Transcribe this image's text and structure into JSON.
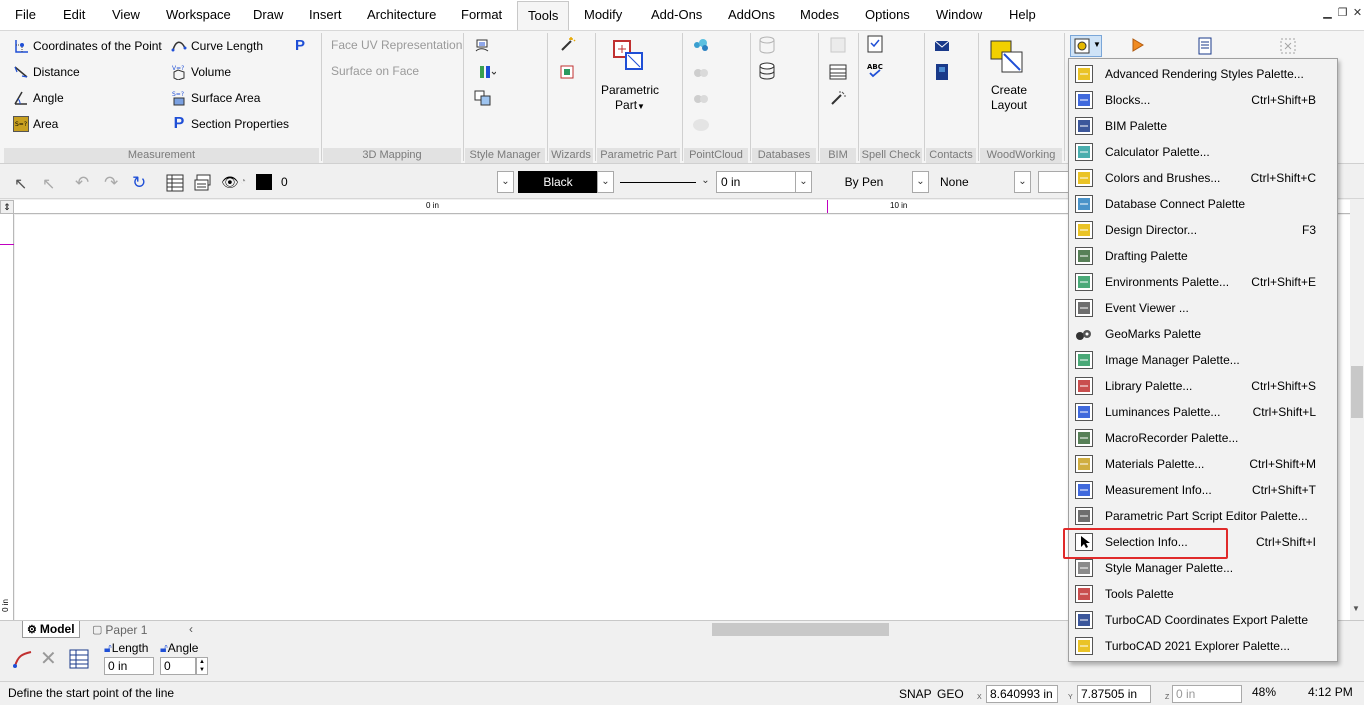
{
  "menubar": {
    "items": [
      "File",
      "Edit",
      "View",
      "Workspace",
      "Draw",
      "Insert",
      "Architecture",
      "Format",
      "Tools",
      "Modify",
      "Add-Ons",
      "AddOns",
      "Modes",
      "Options",
      "Window",
      "Help"
    ],
    "active": "Tools"
  },
  "ribbon": {
    "measurement": {
      "coordinates": "Coordinates of the Point",
      "curve_length": "Curve Length",
      "distance": "Distance",
      "volume": "Volume",
      "angle": "Angle",
      "surface_area": "Surface Area",
      "area": "Area",
      "section_properties": "Section Properties",
      "label": "Measurement"
    },
    "mapping": {
      "face_uv": "Face UV Representation",
      "surface_on_face": "Surface on Face",
      "label": "3D Mapping"
    },
    "style_manager_label": "Style Manager",
    "wizards_label": "Wizards",
    "parametric_part": {
      "line1": "Parametric",
      "line2": "Part",
      "label": "Parametric Part"
    },
    "pointcloud_label": "PointCloud",
    "databases_label": "Databases",
    "bim_label": "BIM",
    "spell_check_label": "Spell Check",
    "contacts_label": "Contacts",
    "create_layout": {
      "line1": "Create",
      "line2": "Layout"
    },
    "woodworking_label": "WoodWorking"
  },
  "propbar": {
    "layer_value": "0",
    "color_value": "Black",
    "line_width": "0 in",
    "pen": "By Pen",
    "none": "None"
  },
  "ruler": {
    "zero": "0 in",
    "ten": "10 in",
    "vertical": "0 in"
  },
  "tabs": {
    "model": "Model",
    "paper": "Paper 1"
  },
  "inspector": {
    "length_label": "Length",
    "length_value": "0 in",
    "angle_label": "Angle",
    "angle_value": "0"
  },
  "statusbar": {
    "message": "Define the start point of the line",
    "snap": "SNAP",
    "geo": "GEO",
    "x_label": "X",
    "x_value": "8.640993 in",
    "y_label": "Y",
    "y_value": "7.87505 in",
    "z_label": "Z",
    "z_value": "0 in",
    "zoom": "48%",
    "time": "4:12 PM"
  },
  "palettes_menu": [
    {
      "label": "Advanced Rendering Styles Palette...",
      "shortcut": "",
      "icon": "rendering-styles-icon"
    },
    {
      "label": "Blocks...",
      "shortcut": "Ctrl+Shift+B",
      "icon": "blocks-icon"
    },
    {
      "label": "BIM Palette",
      "shortcut": "",
      "icon": "bim-icon"
    },
    {
      "label": "Calculator Palette...",
      "shortcut": "",
      "icon": "calculator-icon"
    },
    {
      "label": "Colors and Brushes...",
      "shortcut": "Ctrl+Shift+C",
      "icon": "colors-icon"
    },
    {
      "label": "Database Connect Palette",
      "shortcut": "",
      "icon": "database-icon"
    },
    {
      "label": "Design Director...",
      "shortcut": "F3",
      "icon": "design-director-icon"
    },
    {
      "label": "Drafting Palette",
      "shortcut": "",
      "icon": "drafting-icon"
    },
    {
      "label": "Environments Palette...",
      "shortcut": "Ctrl+Shift+E",
      "icon": "environments-icon"
    },
    {
      "label": "Event Viewer ...",
      "shortcut": "",
      "icon": "event-viewer-icon"
    },
    {
      "label": "GeoMarks Palette",
      "shortcut": "",
      "icon": "geomarks-icon"
    },
    {
      "label": "Image Manager Palette...",
      "shortcut": "",
      "icon": "image-manager-icon"
    },
    {
      "label": "Library Palette...",
      "shortcut": "Ctrl+Shift+S",
      "icon": "library-icon"
    },
    {
      "label": "Luminances Palette...",
      "shortcut": "Ctrl+Shift+L",
      "icon": "luminances-icon"
    },
    {
      "label": "MacroRecorder Palette...",
      "shortcut": "",
      "icon": "macro-recorder-icon"
    },
    {
      "label": "Materials Palette...",
      "shortcut": "Ctrl+Shift+M",
      "icon": "materials-icon"
    },
    {
      "label": "Measurement Info...",
      "shortcut": "Ctrl+Shift+T",
      "icon": "measurement-info-icon"
    },
    {
      "label": "Parametric Part Script Editor Palette...",
      "shortcut": "",
      "icon": "script-editor-icon"
    },
    {
      "label": "Selection Info...",
      "shortcut": "Ctrl+Shift+I",
      "icon": "selection-info-icon"
    },
    {
      "label": "Style Manager Palette...",
      "shortcut": "",
      "icon": "style-manager-icon"
    },
    {
      "label": "Tools Palette",
      "shortcut": "",
      "icon": "tools-palette-icon"
    },
    {
      "label": "TurboCAD Coordinates Export Palette",
      "shortcut": "",
      "icon": "coordinates-export-icon"
    },
    {
      "label": "TurboCAD 2021 Explorer Palette...",
      "shortcut": "",
      "icon": "explorer-icon"
    }
  ],
  "colors": {
    "highlight_border": "#e02a2a",
    "accent_blue": "#1f4fd6",
    "ruler_marker": "#c000c0"
  }
}
